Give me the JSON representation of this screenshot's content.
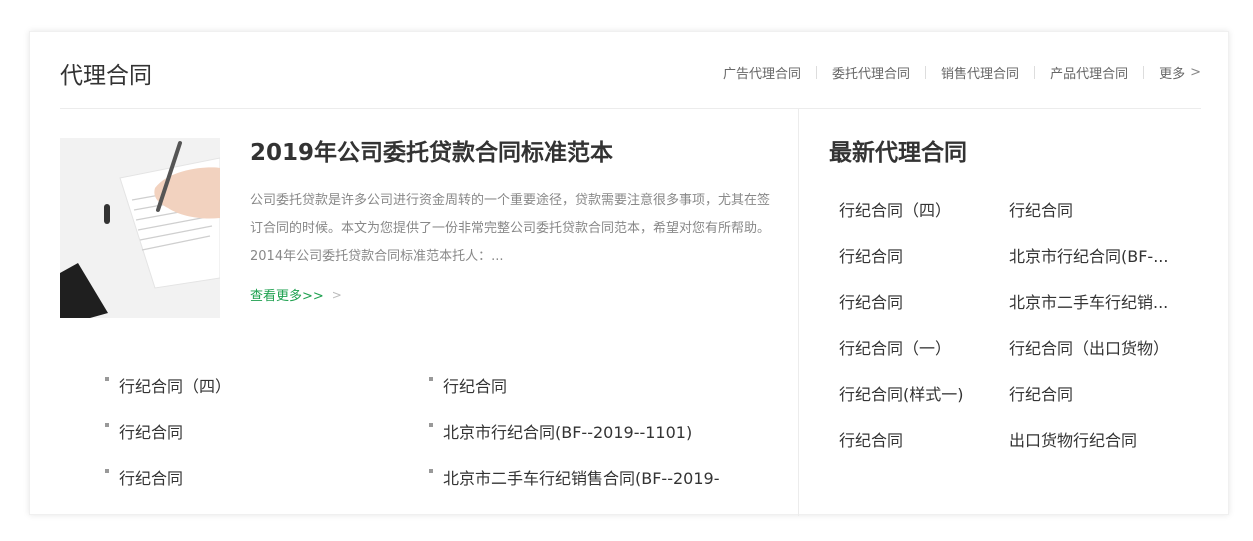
{
  "section": {
    "title": "代理合同",
    "nav": [
      {
        "label": "广告代理合同"
      },
      {
        "label": "委托代理合同"
      },
      {
        "label": "销售代理合同"
      },
      {
        "label": "产品代理合同"
      }
    ],
    "more_label": "更多",
    "more_chevron": ">"
  },
  "feature": {
    "title": "2019年公司委托贷款合同标准范本",
    "description": "公司委托贷款是许多公司进行资金周转的一个重要途径，贷款需要注意很多事项，尤其在签订合同的时候。本文为您提供了一份非常完整公司委托贷款合同范本，希望对您有所帮助。2014年公司委托贷款合同标准范本托人：...",
    "more_label": "查看更多>>",
    "more_arrow": ">",
    "image_icon": "contract-signing-photo"
  },
  "list": [
    {
      "label": "行纪合同（四）"
    },
    {
      "label": "行纪合同"
    },
    {
      "label": "行纪合同"
    },
    {
      "label": "北京市行纪合同(BF--2019--1101)"
    },
    {
      "label": "行纪合同"
    },
    {
      "label": "北京市二手车行纪销售合同(BF--2019-"
    }
  ],
  "latest": {
    "title": "最新代理合同",
    "items": [
      {
        "label": "行纪合同（四）"
      },
      {
        "label": "行纪合同"
      },
      {
        "label": "行纪合同"
      },
      {
        "label": "北京市行纪合同(BF-..."
      },
      {
        "label": "行纪合同"
      },
      {
        "label": "北京市二手车行纪销..."
      },
      {
        "label": "行纪合同（一）"
      },
      {
        "label": "行纪合同（出口货物）"
      },
      {
        "label": "行纪合同(样式一)"
      },
      {
        "label": "行纪合同"
      },
      {
        "label": "行纪合同"
      },
      {
        "label": "出口货物行纪合同"
      }
    ]
  },
  "colors": {
    "accent_green": "#1ea04f",
    "text_dark": "#333333",
    "text_muted": "#888888"
  }
}
